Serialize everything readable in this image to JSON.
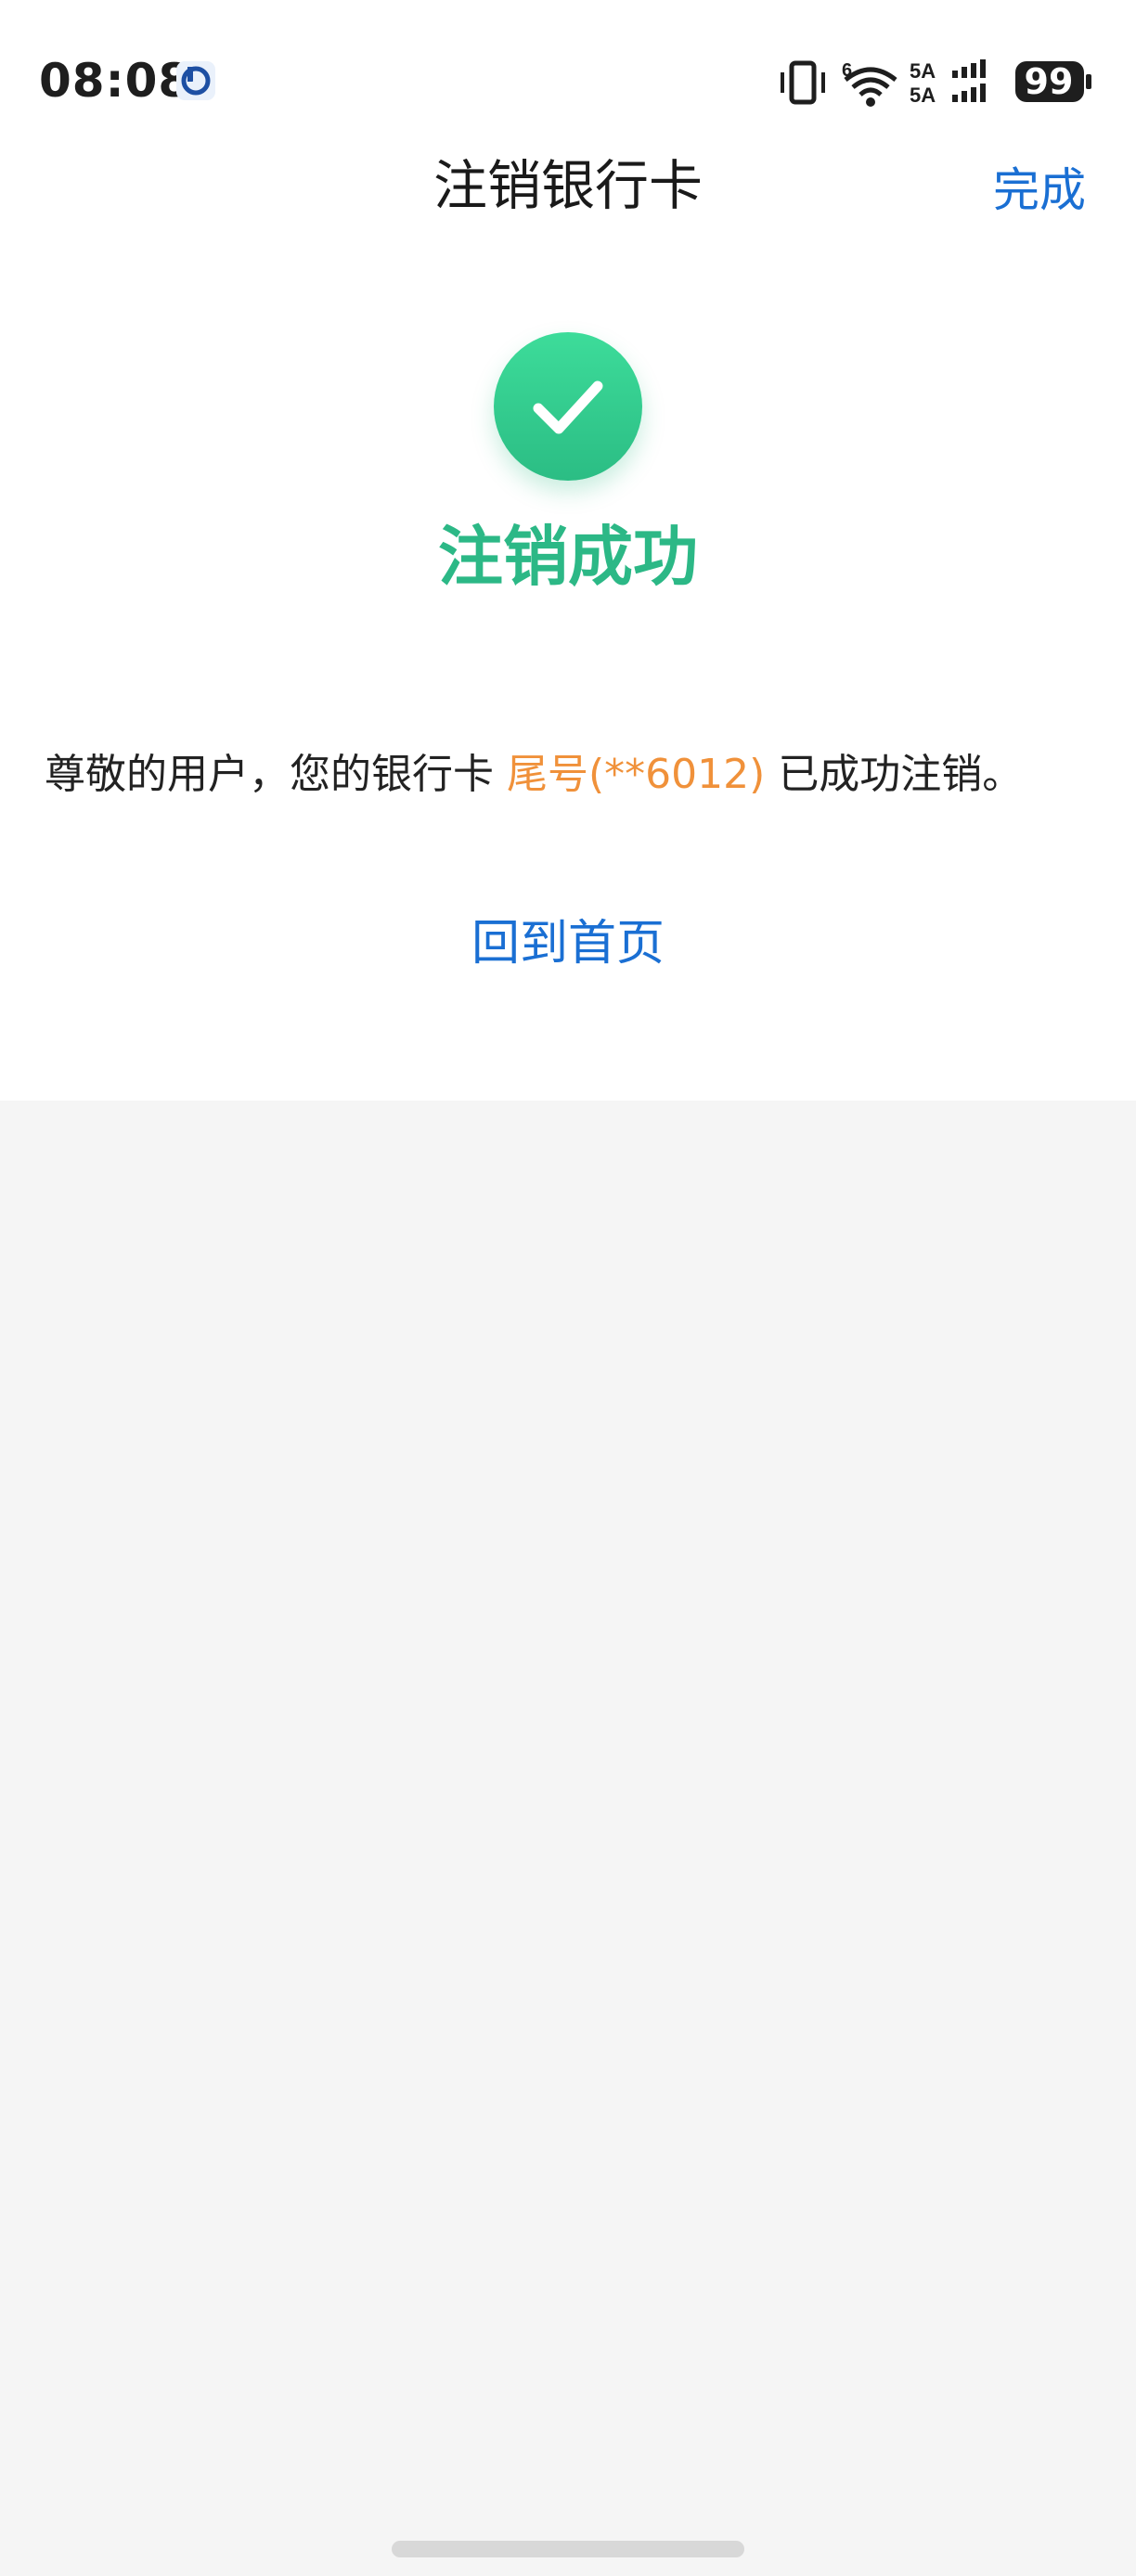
{
  "status_bar": {
    "time": "08:08",
    "battery": "99",
    "icons": [
      "bank-app-notification-icon",
      "vibrate-icon",
      "wifi-icon",
      "signal-icon",
      "battery-icon"
    ]
  },
  "nav": {
    "title": "注销银行卡",
    "done_label": "完成"
  },
  "result": {
    "icon": "checkmark-icon",
    "title": "注销成功",
    "colors": {
      "success": "#2cb886",
      "accent": "#1a6fd3",
      "highlight": "#f0913a"
    }
  },
  "message": {
    "prefix": "尊敬的用户，您的银行卡",
    "card_tail": "尾号(**6012)",
    "suffix": "已成功注销。"
  },
  "actions": {
    "home_label": "回到首页"
  }
}
